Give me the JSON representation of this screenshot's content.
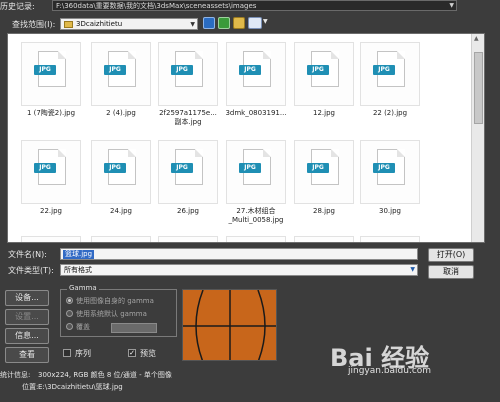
{
  "history": {
    "label": "历史记录:",
    "value": "F:\\360data\\重要数据\\我的文档\\3dsMax\\sceneassets\\images"
  },
  "lookin": {
    "label": "查找范围(I):",
    "folder": "3Dcaizhitietu"
  },
  "toolbar": {
    "icons": [
      "back-icon",
      "up-folder-icon",
      "new-folder-icon",
      "views-icon"
    ]
  },
  "files": [
    {
      "name": "1 (7陶瓷2).jpg"
    },
    {
      "name": "2 (4).jpg"
    },
    {
      "name": "2f2597a1175e...\n副本.jpg"
    },
    {
      "name": "3dmk_0803191..."
    },
    {
      "name": "12.jpg"
    },
    {
      "name": "22 (2).jpg"
    },
    {
      "name": "22.jpg"
    },
    {
      "name": "24.jpg"
    },
    {
      "name": "26.jpg"
    },
    {
      "name": "27.木材组合\n_Multi_0058.jpg"
    },
    {
      "name": "28.jpg"
    },
    {
      "name": "30.jpg"
    }
  ],
  "file_badge": "JPG",
  "filename": {
    "label": "文件名(N):",
    "value": "篮球.jpg"
  },
  "filetype": {
    "label": "文件类型(T):",
    "value": "所有格式"
  },
  "buttons": {
    "open": "打开(O)",
    "cancel": "取消",
    "setup": "设备...",
    "settings": "设置...",
    "info": "信息...",
    "view": "查看"
  },
  "gamma": {
    "title": "Gamma",
    "option1": "使用图像自身的 gamma",
    "option2": "使用系统默认 gamma",
    "option3": "覆盖"
  },
  "sequence": {
    "label": "序列",
    "checked": false
  },
  "preview": {
    "label": "预览",
    "checked": true
  },
  "stats": {
    "label": "统计信息:",
    "value": "300x224, RGB 颜色 8 位/通道 - 单个图像"
  },
  "location": {
    "label": "位置:",
    "value": "E:\\3Dcaizhitietu\\篮球.jpg"
  },
  "watermark": {
    "brand": "Bai 经验",
    "url": "jingyan.baidu.com"
  },
  "colors": {
    "accent": "#1f8fb4",
    "selection": "#316ac5",
    "ball": "#c8661b"
  }
}
